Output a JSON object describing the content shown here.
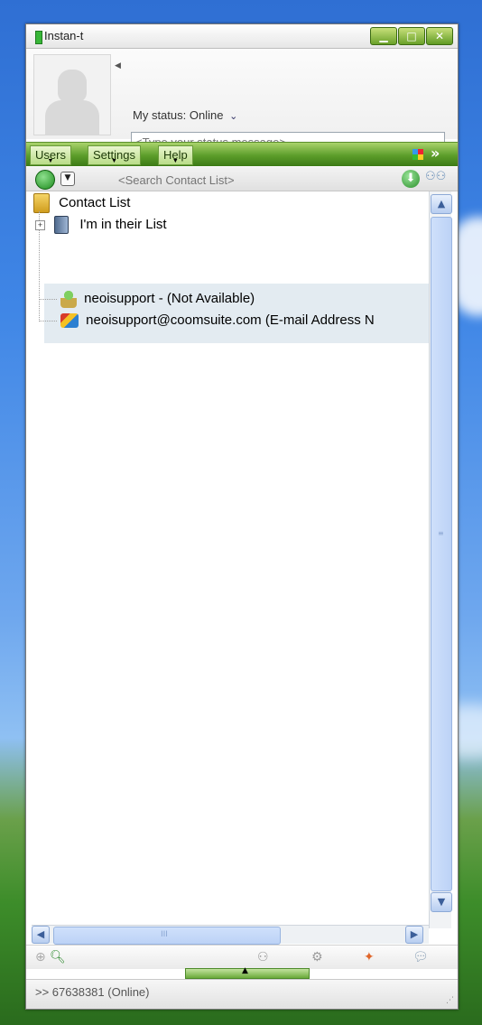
{
  "window": {
    "title": "Instan-t",
    "minimize_label": "▁",
    "maximize_label": "□",
    "close_label": "✕"
  },
  "profile": {
    "status_prefix": "My status:",
    "status_value": "Online",
    "status_chevron": "⌄",
    "status_message_placeholder": "<Type your status message>"
  },
  "menu": {
    "items": [
      "Users",
      "Settings",
      "Help"
    ]
  },
  "search": {
    "placeholder": "<Search Contact List>"
  },
  "tree": {
    "root_label": "Contact List",
    "group_label": "I'm in their List",
    "expand_symbol": "+",
    "contacts": [
      {
        "label": "neoisupport - (Not Available)",
        "icon": "status-away-icon"
      },
      {
        "label": "neoisupport@coomsuite.com (E-mail Address N",
        "icon": "email-contact-icon"
      }
    ]
  },
  "scrollbar": {
    "up": "▲",
    "down": "▼",
    "left": "◀",
    "right": "▶",
    "grip": "III"
  },
  "toolbar": {
    "add_icon": "⊕",
    "search_icon": "🔍︎",
    "people_icon": "⚇",
    "tools_icon": "⚙",
    "msn_icon": "✦",
    "chat_icon": "💬︎"
  },
  "splitter": {
    "arrow": "▲"
  },
  "statusbar": {
    "text": ">> 67638381 (Online)",
    "grip": "⋰"
  },
  "colors": {
    "accent_green": "#5c9d2a",
    "selection_bg": "#e3ebf1",
    "scroll_blue": "#bcd2f6"
  }
}
